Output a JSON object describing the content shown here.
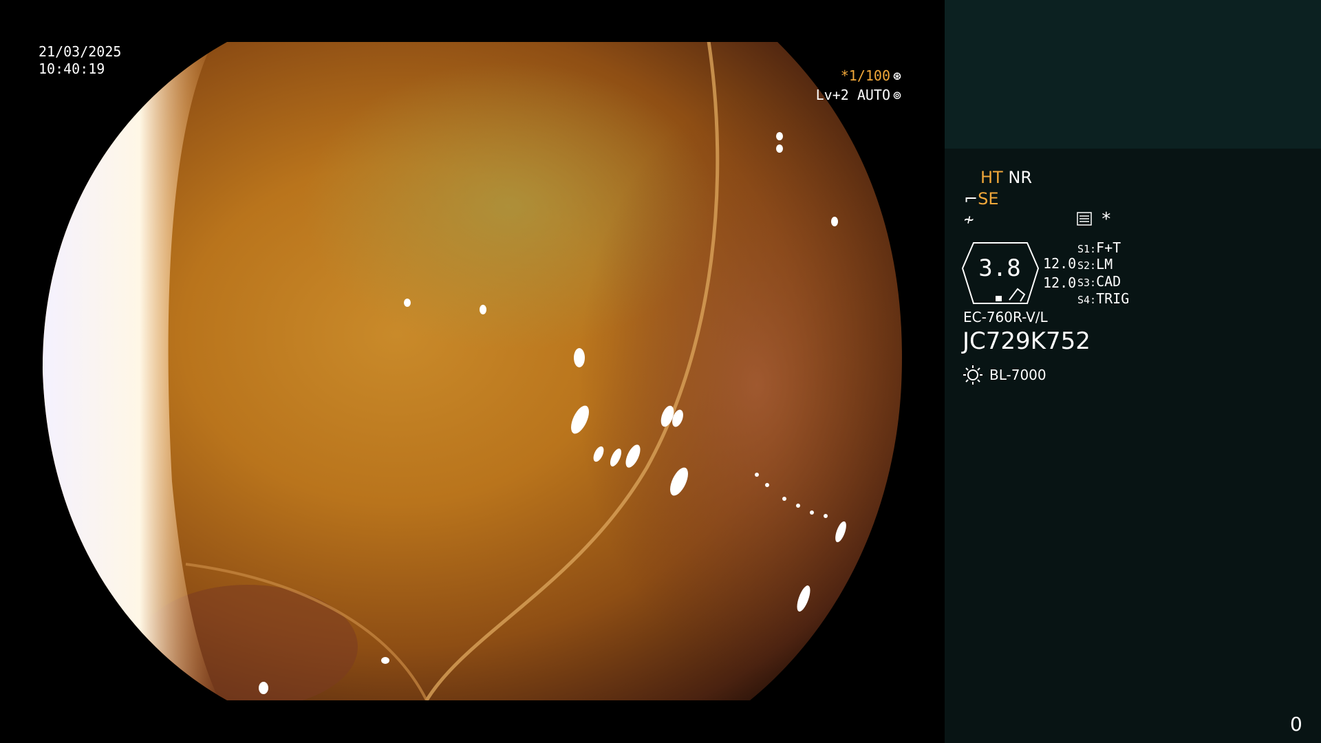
{
  "overlay": {
    "date": "21/03/2025",
    "time": "10:40:19",
    "shutter": "*1/100",
    "level": "Lv+2 AUTO"
  },
  "panel": {
    "ht_label": "HT",
    "nr_label": "NR",
    "se_label": "SE",
    "star": "*",
    "zoom_value": "3.8",
    "value_1": "12.0",
    "value_2": "12.0",
    "slots": [
      {
        "key": "S1:",
        "value": "F+T"
      },
      {
        "key": "S2:",
        "value": "LM"
      },
      {
        "key": "S3:",
        "value": "CAD"
      },
      {
        "key": "S4:",
        "value": "TRIG"
      }
    ],
    "scope_model": "EC-760R-V/L",
    "serial": "JC729K752",
    "light_source": "BL-7000",
    "counter": "0"
  },
  "colors": {
    "accent_orange": "#f2a83a",
    "panel_background": "#081414",
    "panel_top_background": "#0c2121"
  },
  "icons": [
    "shutter-wheel-icon",
    "auto-iris-icon",
    "scope-angle-icon",
    "fiber-icon",
    "menu-list-icon",
    "zoom-frame-icon",
    "light-bulb-icon"
  ]
}
